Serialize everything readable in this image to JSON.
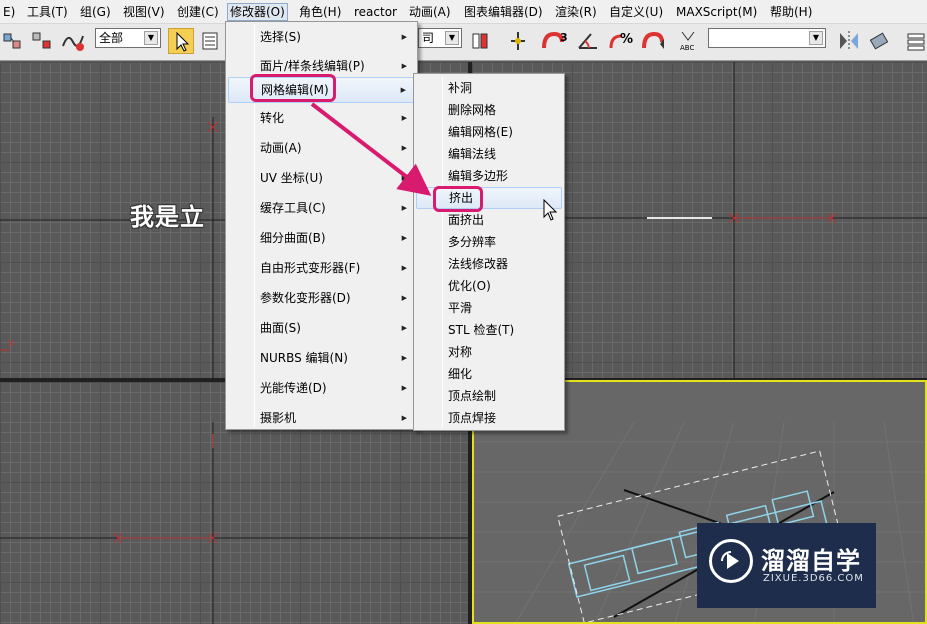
{
  "menubar": {
    "items": [
      "E)",
      "工具(T)",
      "组(G)",
      "视图(V)",
      "创建(C)",
      "修改器(O)",
      "角色(H)",
      "reactor",
      "动画(A)",
      "图表编辑器(D)",
      "渲染(R)",
      "自定义(U)",
      "MAXScript(M)",
      "帮助(H)"
    ]
  },
  "toolbar": {
    "selection_filter": "全部",
    "ref_coord_partial": "司",
    "snap_label": "3",
    "angle_label": "%",
    "named_set": ""
  },
  "modifiers_menu": {
    "items": [
      {
        "label": "选择(S)",
        "has_submenu": true
      },
      {
        "label": "面片/样条线编辑(P)",
        "has_submenu": true
      },
      {
        "label": "网格编辑(M)",
        "has_submenu": true,
        "highlighted": true
      },
      {
        "label": "转化",
        "has_submenu": true
      },
      {
        "label": "动画(A)",
        "has_submenu": true
      },
      {
        "label": "UV 坐标(U)",
        "has_submenu": true
      },
      {
        "label": "缓存工具(C)",
        "has_submenu": true
      },
      {
        "label": "细分曲面(B)",
        "has_submenu": true
      },
      {
        "label": "自由形式变形器(F)",
        "has_submenu": true
      },
      {
        "label": "参数化变形器(D)",
        "has_submenu": true
      },
      {
        "label": "曲面(S)",
        "has_submenu": true
      },
      {
        "label": "NURBS 编辑(N)",
        "has_submenu": true
      },
      {
        "label": "光能传递(D)",
        "has_submenu": true
      },
      {
        "label": "摄影机",
        "has_submenu": true
      }
    ]
  },
  "mesh_edit_submenu": {
    "items": [
      {
        "label": "补洞"
      },
      {
        "label": "删除网格"
      },
      {
        "label": "编辑网格(E)"
      },
      {
        "label": "编辑法线"
      },
      {
        "label": "编辑多边形"
      },
      {
        "label": "挤出",
        "highlighted": true
      },
      {
        "label": "面挤出"
      },
      {
        "label": "多分辨率"
      },
      {
        "label": "法线修改器"
      },
      {
        "label": "优化(O)"
      },
      {
        "label": "平滑"
      },
      {
        "label": "STL 检查(T)"
      },
      {
        "label": "对称"
      },
      {
        "label": "细化"
      },
      {
        "label": "顶点绘制"
      },
      {
        "label": "顶点焊接"
      }
    ]
  },
  "viewport": {
    "overlay_text": "我是立",
    "axis_label": "x"
  },
  "watermark": {
    "title": "溜溜自学",
    "url": "ZIXUE.3D66.COM"
  },
  "colors": {
    "callout": "#d81b6e",
    "menu_highlight": "#dde9f7",
    "active_viewport": "#e4e21f",
    "watermark_bg": "#1e2d4b"
  }
}
